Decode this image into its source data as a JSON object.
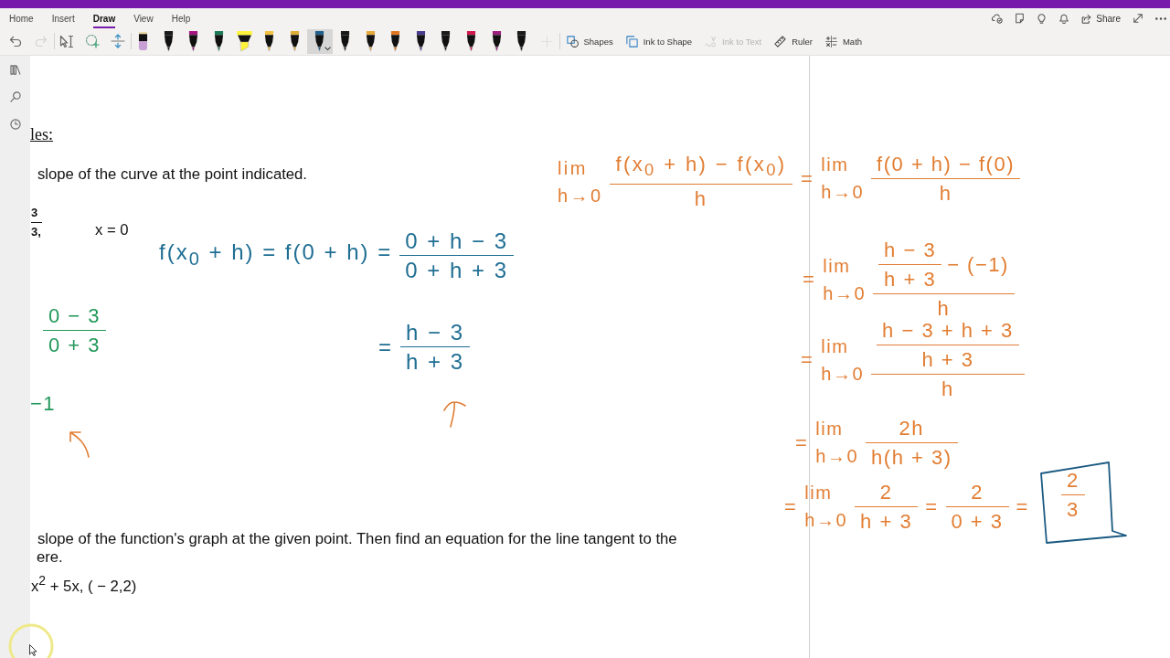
{
  "tabs": [
    {
      "label": "Home",
      "selected": false
    },
    {
      "label": "Insert",
      "selected": false
    },
    {
      "label": "Draw",
      "selected": true
    },
    {
      "label": "View",
      "selected": false
    },
    {
      "label": "Help",
      "selected": false
    }
  ],
  "share": {
    "label": "Share"
  },
  "toolbar": {
    "tools": [
      {
        "disabled": false
      },
      {
        "disabled": true
      },
      {
        "disabled": false
      },
      {
        "disabled": false
      },
      {
        "disabled": false
      }
    ],
    "pens": [
      {
        "kind": "eraser",
        "color": "#c9a0d6",
        "selected": false
      },
      {
        "kind": "pen",
        "color": "#1a1a1a",
        "selected": false
      },
      {
        "kind": "pen",
        "color": "#a3157e",
        "selected": false
      },
      {
        "kind": "pen",
        "color": "#1b7a55",
        "selected": false
      },
      {
        "kind": "highlighter",
        "color": "#fff23a",
        "selected": false
      },
      {
        "kind": "pen",
        "color": "#f0c040",
        "selected": false
      },
      {
        "kind": "pen",
        "color": "#dcae38",
        "selected": false
      },
      {
        "kind": "pen",
        "color": "#1e5f8c",
        "selected": true
      },
      {
        "kind": "pen",
        "color": "#1a1a1a",
        "selected": false
      },
      {
        "kind": "pen",
        "color": "#e5a93a",
        "selected": false
      },
      {
        "kind": "pen",
        "color": "#e0761f",
        "selected": false
      },
      {
        "kind": "pen",
        "color": "#4a3c8c",
        "selected": false
      },
      {
        "kind": "pen",
        "color": "#1a1a1a",
        "selected": false
      },
      {
        "kind": "pen",
        "color": "#d1184c",
        "selected": false
      },
      {
        "kind": "pen",
        "color": "#9b1f7d",
        "selected": false
      },
      {
        "kind": "pen",
        "color": "#1a1a1a",
        "selected": false
      }
    ],
    "add_pen": {
      "disabled": true
    },
    "actions": [
      {
        "label": "Shapes",
        "disabled": false
      },
      {
        "label": "Ink to Shape",
        "disabled": false
      },
      {
        "label": "Ink to Text",
        "disabled": true
      },
      {
        "label": "Ruler",
        "disabled": false
      },
      {
        "label": "Math",
        "disabled": false
      }
    ]
  },
  "page": {
    "printed": [
      {
        "kind": "heading",
        "text": "les:"
      },
      {
        "kind": "text",
        "text": "slope of the curve at the point indicated."
      },
      {
        "kind": "fraction",
        "num": "3",
        "den": "3,"
      },
      {
        "kind": "math",
        "text": "x = 0"
      },
      {
        "kind": "text",
        "text": "slope of the function's graph at the given point. Then find an equation for the line tangent to the"
      },
      {
        "kind": "text",
        "text": "ere."
      },
      {
        "kind": "math",
        "text": "x$^{2}$ + 5x, ( − 2,2)"
      }
    ],
    "ink": [
      {
        "kind": "math",
        "color": "#22985a",
        "parts": [
          {
            "kind": "frac",
            "num": "0 − 3",
            "den": "0 + 3"
          }
        ]
      },
      {
        "kind": "math",
        "color": "#22985a",
        "parts": [
          {
            "kind": "text",
            "text": "−1"
          }
        ]
      },
      {
        "kind": "arrow",
        "color": "#e27d32"
      },
      {
        "kind": "math",
        "color": "#1f6e93",
        "parts": [
          {
            "kind": "text",
            "text": "f(x$_{0}$ + h) = f(0 + h) ="
          },
          {
            "kind": "frac",
            "num": "0 + h − 3",
            "den": "0 + h + 3"
          }
        ]
      },
      {
        "kind": "math",
        "color": "#1f6e93",
        "parts": [
          {
            "kind": "text",
            "text": "="
          },
          {
            "kind": "frac",
            "num": "h − 3",
            "den": "h + 3"
          }
        ]
      },
      {
        "kind": "arrow",
        "color": "#e27d32"
      },
      {
        "kind": "math",
        "color": "#e27d32",
        "parts": [
          {
            "kind": "lim",
            "over": "lim",
            "under": "h→0"
          },
          {
            "kind": "frac",
            "num": "f(x$_{0}$ + h) − f(x$_{0}$)",
            "den": "h"
          }
        ]
      },
      {
        "kind": "math",
        "color": "#e27d32",
        "parts": [
          {
            "kind": "text",
            "text": "="
          },
          {
            "kind": "lim",
            "over": "lim",
            "under": "h→0"
          },
          {
            "kind": "frac",
            "num": "f(0 + h) − f(0)",
            "den": "h"
          }
        ]
      },
      {
        "kind": "math",
        "color": "#e27d32",
        "parts": [
          {
            "kind": "text",
            "text": "="
          },
          {
            "kind": "lim",
            "over": "lim",
            "under": "h→0"
          },
          {
            "kind": "frac",
            "num": [
              {
                "kind": "frac",
                "num": "h − 3",
                "den": "h + 3"
              },
              {
                "kind": "text",
                "text": "− (−1)"
              }
            ],
            "den": "h"
          }
        ]
      },
      {
        "kind": "math",
        "color": "#e27d32",
        "parts": [
          {
            "kind": "text",
            "text": "="
          },
          {
            "kind": "lim",
            "over": "lim",
            "under": "h→0"
          },
          {
            "kind": "frac",
            "num": [
              {
                "kind": "frac",
                "num": "h − 3 + h + 3",
                "den": "h + 3"
              }
            ],
            "den": "h"
          }
        ]
      },
      {
        "kind": "math",
        "color": "#e27d32",
        "parts": [
          {
            "kind": "text",
            "text": "="
          },
          {
            "kind": "lim",
            "over": "lim",
            "under": "h→0"
          },
          {
            "kind": "frac",
            "num": "2h",
            "den": "h(h + 3)"
          }
        ]
      },
      {
        "kind": "math",
        "color": "#e27d32",
        "parts": [
          {
            "kind": "text",
            "text": "="
          },
          {
            "kind": "lim",
            "over": "lim",
            "under": "h→0"
          },
          {
            "kind": "frac",
            "num": "2",
            "den": "h + 3"
          },
          {
            "kind": "text",
            "text": "="
          },
          {
            "kind": "frac",
            "num": "2",
            "den": "0 + 3"
          },
          {
            "kind": "text",
            "text": "="
          }
        ]
      },
      {
        "kind": "box",
        "color": "#1b5a82"
      },
      {
        "kind": "math",
        "color": "#e27d32",
        "parts": [
          {
            "kind": "frac",
            "num": "2",
            "den": "3"
          }
        ]
      }
    ]
  }
}
